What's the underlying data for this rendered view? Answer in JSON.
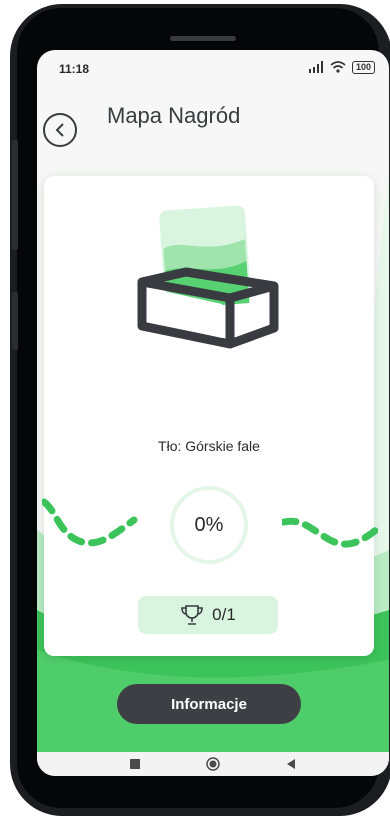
{
  "status": {
    "time": "11:18",
    "signal_icon": "signal-icon",
    "wifi_icon": "wifi-icon",
    "battery": "100"
  },
  "header": {
    "back_icon": "chevron-left-icon",
    "title": "Mapa Nagród"
  },
  "reward": {
    "name": "Tło: Górskie fale",
    "progress": "0%",
    "trophy_icon": "trophy-icon",
    "trophy_count": "0/1"
  },
  "footer": {
    "info_label": "Informacje"
  },
  "nav": {
    "items": [
      "square-icon",
      "circle-icon",
      "triangle-back-icon"
    ]
  },
  "colors": {
    "accent": "#3cc45a",
    "accent_light": "#d9f5df",
    "dark": "#3d3f45"
  }
}
